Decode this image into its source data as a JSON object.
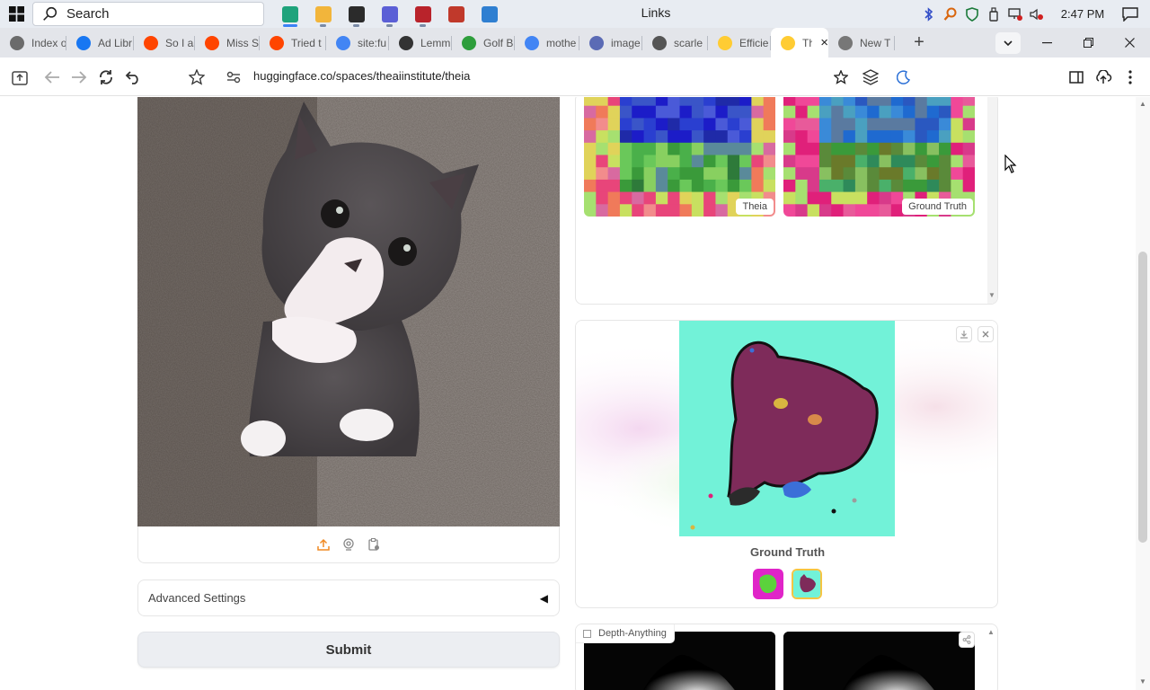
{
  "taskbar": {
    "search_placeholder": "Search",
    "window_title": "Links",
    "clock": "2:47 PM",
    "pinned_apps": [
      {
        "name": "edge-app",
        "color": "#1fa37c"
      },
      {
        "name": "file-explorer-app",
        "color": "#f2b53b"
      },
      {
        "name": "terminal-app",
        "color": "#2b2b2b"
      },
      {
        "name": "feather-app",
        "color": "#5b5fd6"
      },
      {
        "name": "exe-app",
        "color": "#b9232b"
      },
      {
        "name": "chart-app",
        "color": "#c0392b"
      },
      {
        "name": "image-app",
        "color": "#2f7fd1"
      }
    ]
  },
  "tabs": [
    {
      "label": "Index o",
      "favicon": "globe-icon",
      "color": "#6b6b6b"
    },
    {
      "label": "Ad Libr",
      "favicon": "meta-icon",
      "color": "#1877f2"
    },
    {
      "label": "So I as",
      "favicon": "reddit-icon",
      "color": "#ff4500"
    },
    {
      "label": "Miss S",
      "favicon": "reddit-icon",
      "color": "#ff4500"
    },
    {
      "label": "Tried t",
      "favicon": "reddit-icon",
      "color": "#ff4500"
    },
    {
      "label": "site:fu",
      "favicon": "google-icon",
      "color": "#4285f4"
    },
    {
      "label": "Lemm",
      "favicon": "lemmy-icon",
      "color": "#333333"
    },
    {
      "label": "Golf B",
      "favicon": "golf-icon",
      "color": "#2e9e3c"
    },
    {
      "label": "mothe",
      "favicon": "google-icon",
      "color": "#4285f4"
    },
    {
      "label": "image",
      "favicon": "image-icon",
      "color": "#5b6bb5"
    },
    {
      "label": "scarle",
      "favicon": "globe-icon",
      "color": "#555555"
    },
    {
      "label": "Efficie",
      "favicon": "huggingface-icon",
      "color": "#ffcc33"
    },
    {
      "label": "Th",
      "favicon": "huggingface-icon",
      "color": "#ffcc33",
      "active": true
    },
    {
      "label": "New T",
      "favicon": "page-icon",
      "color": "#777777"
    }
  ],
  "address_bar": {
    "url": "huggingface.co/spaces/theaiinstitute/theia"
  },
  "left_panel": {
    "advanced_settings_label": "Advanced Settings",
    "submit_label": "Submit"
  },
  "gallery_top": {
    "labels": [
      "Theia",
      "Ground Truth"
    ]
  },
  "gallery_seg": {
    "caption": "Ground Truth"
  },
  "depth_block": {
    "label": "Depth-Anything"
  }
}
